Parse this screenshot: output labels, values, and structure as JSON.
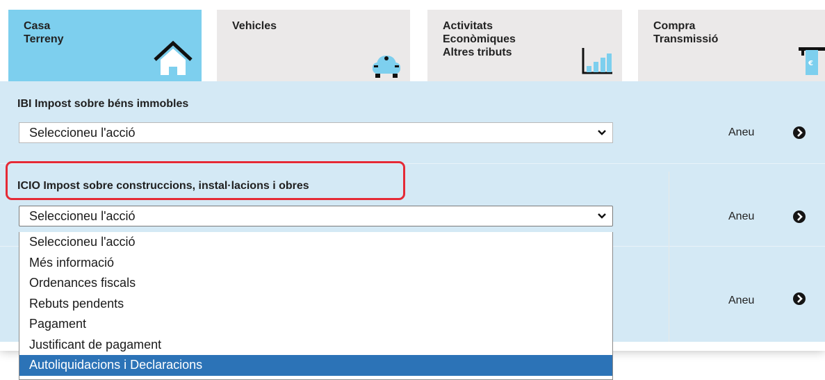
{
  "tabs": [
    {
      "lines": [
        "Casa",
        "Terreny"
      ],
      "icon": "house-icon",
      "active": true
    },
    {
      "lines": [
        "Vehicles"
      ],
      "icon": "car-icon",
      "active": false
    },
    {
      "lines": [
        "Activitats",
        "Econòmiques",
        "Altres tributs"
      ],
      "icon": "bar-chart-icon",
      "active": false
    },
    {
      "lines": [
        "Compra",
        "Transmissió"
      ],
      "icon": "atm-icon",
      "active": false
    }
  ],
  "sections": [
    {
      "title": "IBI Impost sobre béns immobles",
      "select_value": "Seleccioneu l'acció",
      "go_label": "Aneu"
    },
    {
      "title": "ICIO Impost sobre construccions, instal·lacions i obres",
      "select_value": "Seleccioneu l'acció",
      "go_label": "Aneu"
    },
    {
      "title": "",
      "select_value": "",
      "go_label": "Aneu"
    }
  ],
  "dropdown": {
    "options": [
      "Seleccioneu l'acció",
      "Més informació",
      "Ordenances fiscals",
      "Rebuts pendents",
      "Pagament",
      "Justificant de pagament",
      "Autoliquidacions i Declaracions"
    ],
    "highlighted_index": 6
  },
  "colors": {
    "active_tab": "#7dcfee",
    "inactive_tab": "#ebe9e9",
    "panel": "#d4e9f5",
    "highlight_border": "#e52a36",
    "selected_option": "#2c73b7"
  }
}
